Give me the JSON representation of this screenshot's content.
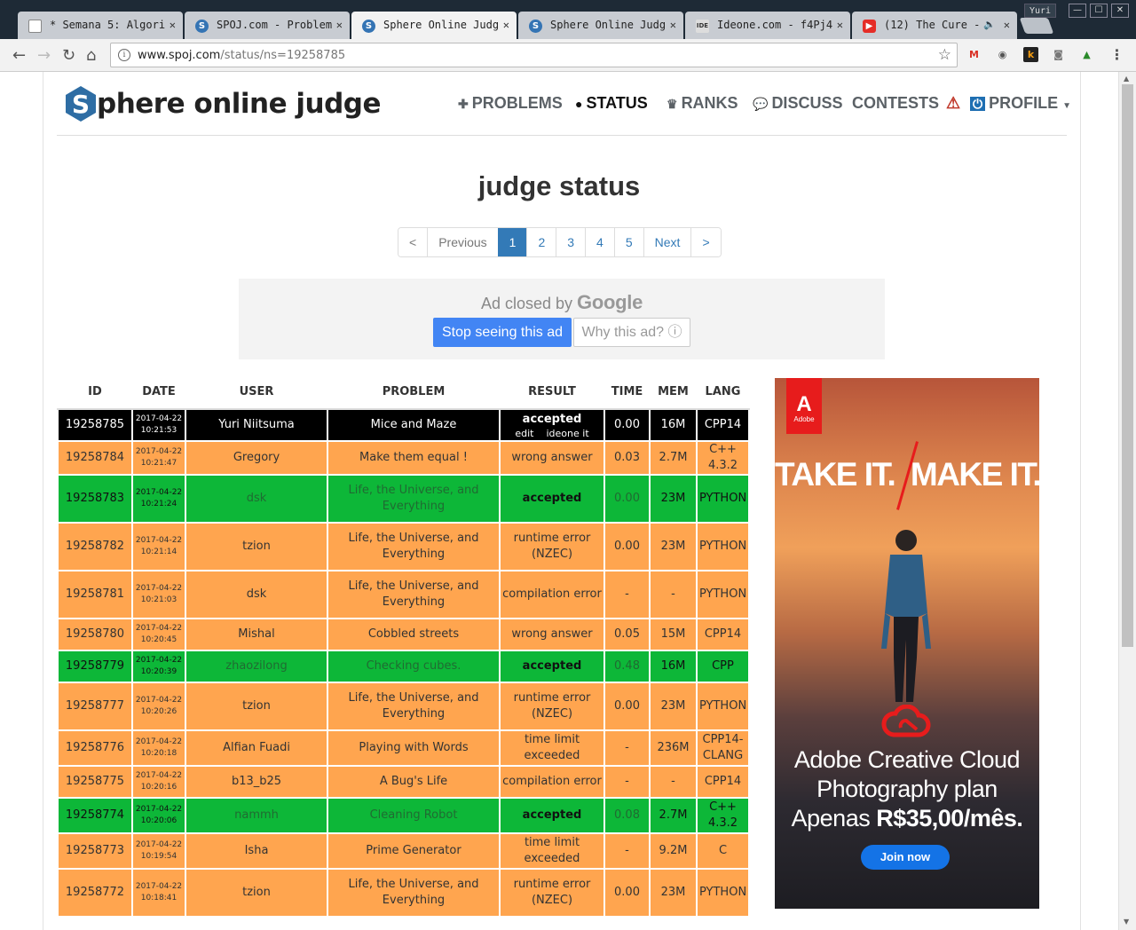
{
  "browser": {
    "tabs": [
      {
        "title": "* Semana 5: Algori",
        "favicon": "pin-icon"
      },
      {
        "title": "SPOJ.com - Problem",
        "favicon": "spoj-icon"
      },
      {
        "title": "Sphere Online Judg",
        "favicon": "spoj-icon",
        "active": true
      },
      {
        "title": "Sphere Online Judg",
        "favicon": "spoj-icon"
      },
      {
        "title": "Ideone.com - f4Pj4",
        "favicon": "ideone-icon"
      },
      {
        "title": "(12) The Cure -",
        "favicon": "youtube-icon"
      }
    ],
    "profile_name": "Yuri",
    "url_host": "www.spoj.com",
    "url_path": "/status/ns=19258785"
  },
  "site": {
    "logo_text": "phere online judge",
    "logo_letter": "S",
    "nav": {
      "problems": "PROBLEMS",
      "status": "STATUS",
      "ranks": "RANKS",
      "discuss": "DISCUSS",
      "contests": "CONTESTS",
      "profile": "PROFILE"
    }
  },
  "page_title": "judge status",
  "pagination": {
    "first": "<",
    "previous": "Previous",
    "pages": [
      "1",
      "2",
      "3",
      "4",
      "5"
    ],
    "current": "1",
    "next": "Next",
    "last": ">"
  },
  "ad_closed": {
    "message": "Ad closed by",
    "brand": "Google",
    "stop_label": "Stop seeing this ad",
    "why_label": "Why this ad? ⓘ"
  },
  "table": {
    "headers": {
      "id": "ID",
      "date": "DATE",
      "user": "USER",
      "problem": "PROBLEM",
      "result": "RESULT",
      "time": "TIME",
      "mem": "MEM",
      "lang": "LANG"
    },
    "rows": [
      {
        "id": "19258785",
        "date": "2017-04-22",
        "clock": "10:21:53",
        "user": "Yuri Niitsuma",
        "problem": "Mice and Maze",
        "result": "accepted",
        "status": "mine",
        "time": "0.00",
        "mem": "16M",
        "lang": "CPP14",
        "edit": "edit",
        "ideone": "ideone it"
      },
      {
        "id": "19258784",
        "date": "2017-04-22",
        "clock": "10:21:47",
        "user": "Gregory",
        "problem": "Make them equal !",
        "result": "wrong answer",
        "status": "wa",
        "time": "0.03",
        "mem": "2.7M",
        "lang": "C++ 4.3.2"
      },
      {
        "id": "19258783",
        "date": "2017-04-22",
        "clock": "10:21:24",
        "user": "dsk",
        "problem": "Life, the Universe, and Everything",
        "result": "accepted",
        "status": "ac",
        "time": "0.00",
        "mem": "23M",
        "lang": "PYTHON"
      },
      {
        "id": "19258782",
        "date": "2017-04-22",
        "clock": "10:21:14",
        "user": "tzion",
        "problem": "Life, the Universe, and Everything",
        "result": "runtime error (NZEC)",
        "status": "wa",
        "time": "0.00",
        "mem": "23M",
        "lang": "PYTHON"
      },
      {
        "id": "19258781",
        "date": "2017-04-22",
        "clock": "10:21:03",
        "user": "dsk",
        "problem": "Life, the Universe, and Everything",
        "result": "compilation error",
        "status": "wa",
        "time": "-",
        "mem": "-",
        "lang": "PYTHON"
      },
      {
        "id": "19258780",
        "date": "2017-04-22",
        "clock": "10:20:45",
        "user": "Mishal",
        "problem": "Cobbled streets",
        "result": "wrong answer",
        "status": "wa",
        "time": "0.05",
        "mem": "15M",
        "lang": "CPP14"
      },
      {
        "id": "19258779",
        "date": "2017-04-22",
        "clock": "10:20:39",
        "user": "zhaozilong",
        "problem": "Checking cubes.",
        "result": "accepted",
        "status": "ac",
        "time": "0.48",
        "mem": "16M",
        "lang": "CPP"
      },
      {
        "id": "19258777",
        "date": "2017-04-22",
        "clock": "10:20:26",
        "user": "tzion",
        "problem": "Life, the Universe, and Everything",
        "result": "runtime error (NZEC)",
        "status": "wa",
        "time": "0.00",
        "mem": "23M",
        "lang": "PYTHON"
      },
      {
        "id": "19258776",
        "date": "2017-04-22",
        "clock": "10:20:18",
        "user": "Alfian Fuadi",
        "problem": "Playing with Words",
        "result": "time limit exceeded",
        "status": "wa",
        "time": "-",
        "mem": "236M",
        "lang": "CPP14-CLANG"
      },
      {
        "id": "19258775",
        "date": "2017-04-22",
        "clock": "10:20:16",
        "user": "b13_b25",
        "problem": "A Bug's Life",
        "result": "compilation error",
        "status": "wa",
        "time": "-",
        "mem": "-",
        "lang": "CPP14"
      },
      {
        "id": "19258774",
        "date": "2017-04-22",
        "clock": "10:20:06",
        "user": "nammh",
        "problem": "Cleaning Robot",
        "result": "accepted",
        "status": "ac",
        "time": "0.08",
        "mem": "2.7M",
        "lang": "C++ 4.3.2"
      },
      {
        "id": "19258773",
        "date": "2017-04-22",
        "clock": "10:19:54",
        "user": "Isha",
        "problem": "Prime Generator",
        "result": "time limit exceeded",
        "status": "wa",
        "time": "-",
        "mem": "9.2M",
        "lang": "C"
      },
      {
        "id": "19258772",
        "date": "2017-04-22",
        "clock": "10:18:41",
        "user": "tzion",
        "problem": "Life, the Universe, and Everything",
        "result": "runtime error (NZEC)",
        "status": "wa",
        "time": "0.00",
        "mem": "23M",
        "lang": "PYTHON"
      }
    ]
  },
  "side_ad": {
    "brand": "Adobe",
    "slogan_left": "TAKE IT.",
    "slogan_right": "MAKE IT.",
    "line1": "Adobe Creative Cloud",
    "line2": "Photography plan",
    "line3_prefix": "Apenas",
    "line3_price": "R$35,00/mês.",
    "cta": "Join now"
  },
  "colors": {
    "wrong": "#ffa54f",
    "accepted": "#0db738",
    "mine": "#000000",
    "link": "#337ab7"
  }
}
